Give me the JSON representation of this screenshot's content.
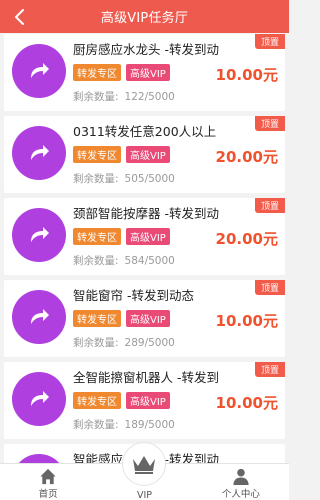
{
  "header": {
    "title": "高级VIP任务厅"
  },
  "tasks": [
    {
      "name": "厨房感应水龙头 -转发到动",
      "badge": "顶置",
      "tag_a": "转发专区",
      "tag_b": "高级VIP",
      "remain_label": "剩余数量:",
      "remain_value": "122/5000",
      "price": "10.00元"
    },
    {
      "name": "0311转发任意200人以上",
      "badge": "顶置",
      "tag_a": "转发专区",
      "tag_b": "高级VIP",
      "remain_label": "剩余数量:",
      "remain_value": "505/5000",
      "price": "20.00元"
    },
    {
      "name": "颈部智能按摩器 -转发到动",
      "badge": "顶置",
      "tag_a": "转发专区",
      "tag_b": "高级VIP",
      "remain_label": "剩余数量:",
      "remain_value": "584/5000",
      "price": "20.00元"
    },
    {
      "name": "智能窗帘 -转发到动态",
      "badge": "顶置",
      "tag_a": "转发专区",
      "tag_b": "高级VIP",
      "remain_label": "剩余数量:",
      "remain_value": "289/5000",
      "price": "10.00元"
    },
    {
      "name": "全智能擦窗机器人 -转发到",
      "badge": "顶置",
      "tag_a": "转发专区",
      "tag_b": "高级VIP",
      "remain_label": "剩余数量:",
      "remain_value": "189/5000",
      "price": "10.00元"
    },
    {
      "name": "智能感应垃圾桶 -转发到动",
      "badge": "",
      "tag_a": "",
      "tag_b": "",
      "remain_label": "",
      "remain_value": "",
      "price": ""
    }
  ],
  "tabbar": {
    "home": "首页",
    "vip": "VIP",
    "me": "个人中心"
  },
  "colors": {
    "header": "#ef5a4f",
    "thumb": "#b03fe0",
    "price": "#f0522e"
  }
}
